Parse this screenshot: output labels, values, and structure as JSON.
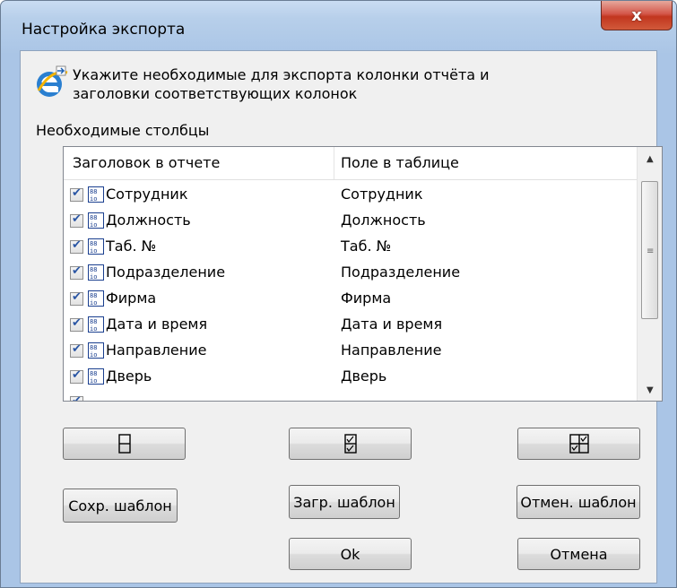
{
  "window": {
    "title": "Настройка экспорта",
    "close_glyph": "x"
  },
  "instruction": {
    "text_line1": "Укажите необходимые для экспорта колонки отчёта и",
    "text_line2": "заголовки соответствующих колонок"
  },
  "group": {
    "label": "Необходимые столбцы"
  },
  "list": {
    "headers": [
      "Заголовок в отчете",
      "Поле в таблице"
    ],
    "rows": [
      {
        "title": "Сотрудник",
        "field": "Сотрудник",
        "checked": true
      },
      {
        "title": "Должность",
        "field": "Должность",
        "checked": true
      },
      {
        "title": "Таб. №",
        "field": "Таб. №",
        "checked": true
      },
      {
        "title": "Подразделение",
        "field": "Подразделение",
        "checked": true
      },
      {
        "title": "Фирма",
        "field": "Фирма",
        "checked": true
      },
      {
        "title": "Дата и время",
        "field": "Дата и время",
        "checked": true
      },
      {
        "title": "Направление",
        "field": "Направление",
        "checked": true
      },
      {
        "title": "Дверь",
        "field": "Дверь",
        "checked": true
      }
    ]
  },
  "buttons": {
    "save_template": "Сохр. шаблон",
    "load_template": "Загр. шаблон",
    "cancel_template": "Отмен. шаблон",
    "ok": "Ok",
    "cancel": "Отмена"
  },
  "icons": {
    "header": "ie-export-icon",
    "field": "field-icon",
    "select_none": "column-empty-icon",
    "select_all": "column-checked-icon",
    "invert": "grid-toggle-icon"
  },
  "colors": {
    "check": "#2b56a4",
    "close": "#c2361f",
    "frame": "#b7cfea"
  }
}
